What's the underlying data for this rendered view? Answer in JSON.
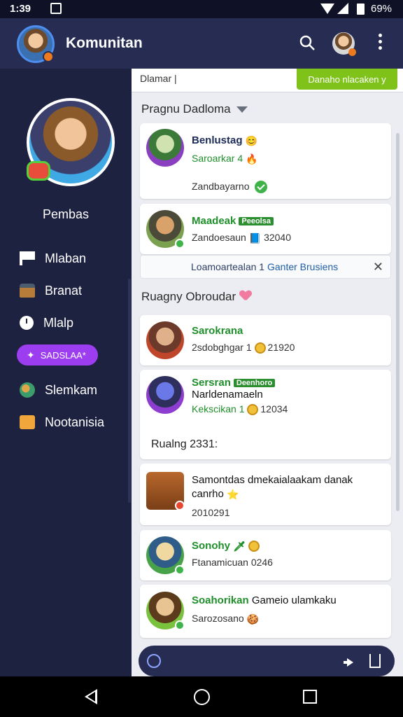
{
  "status_bar": {
    "time": "1:39",
    "battery": "69%"
  },
  "app_bar": {
    "title": "Komunitan"
  },
  "sidebar": {
    "profile_name": "Pembas",
    "items": [
      {
        "label": "Mlaban",
        "icon": "flag-icon"
      },
      {
        "label": "Branat",
        "icon": "chest-icon"
      },
      {
        "label": "Mlalp",
        "icon": "clock-icon"
      },
      {
        "label": "Slemkam",
        "icon": "globe-icon"
      },
      {
        "label": "Nootanisia",
        "icon": "puzzle-icon"
      }
    ],
    "badge_label": "SADSLAA*"
  },
  "main": {
    "filter_label": "Dlamar |",
    "cta_label": "Danaho nlacaken y",
    "section1": {
      "title": "Pragnu Dadloma"
    },
    "section2": {
      "title": "Ruagny Obroudar"
    },
    "section3": {
      "title": "Rualng 2331:"
    },
    "cards": [
      {
        "name": "Benlustag",
        "sub": "Saroarkar 4",
        "line": "Zandbayarno"
      },
      {
        "name": "Maadeak",
        "tag": "Peeolsa",
        "sub": "Zandoesaun",
        "extra": "32040"
      },
      {
        "name": "Sarokrana",
        "sub": "2sdobghgar 1",
        "extra": "21920"
      },
      {
        "name": "Sersran",
        "tag": "Deenhoro",
        "line": "Narldenamaeln",
        "sub": "Kekscikan 1",
        "extra": "12034"
      },
      {
        "line": "Samontdas dmekaialaakam danak canrho",
        "sub": "2010291"
      },
      {
        "name": "Sonohy",
        "sub": "Ftanamicuan",
        "extra": "0246"
      },
      {
        "name": "Soahorikan",
        "line_suffix": "Gameio ulamkaku",
        "sub": "Sarozosano"
      }
    ],
    "share_row": {
      "left": "Loamoartealan",
      "num": "1",
      "right": "Ganter Brusiens"
    }
  },
  "colors": {
    "accent_green": "#7ec21a",
    "accent_purple": "#9d3df0",
    "appbar": "#262c52"
  }
}
